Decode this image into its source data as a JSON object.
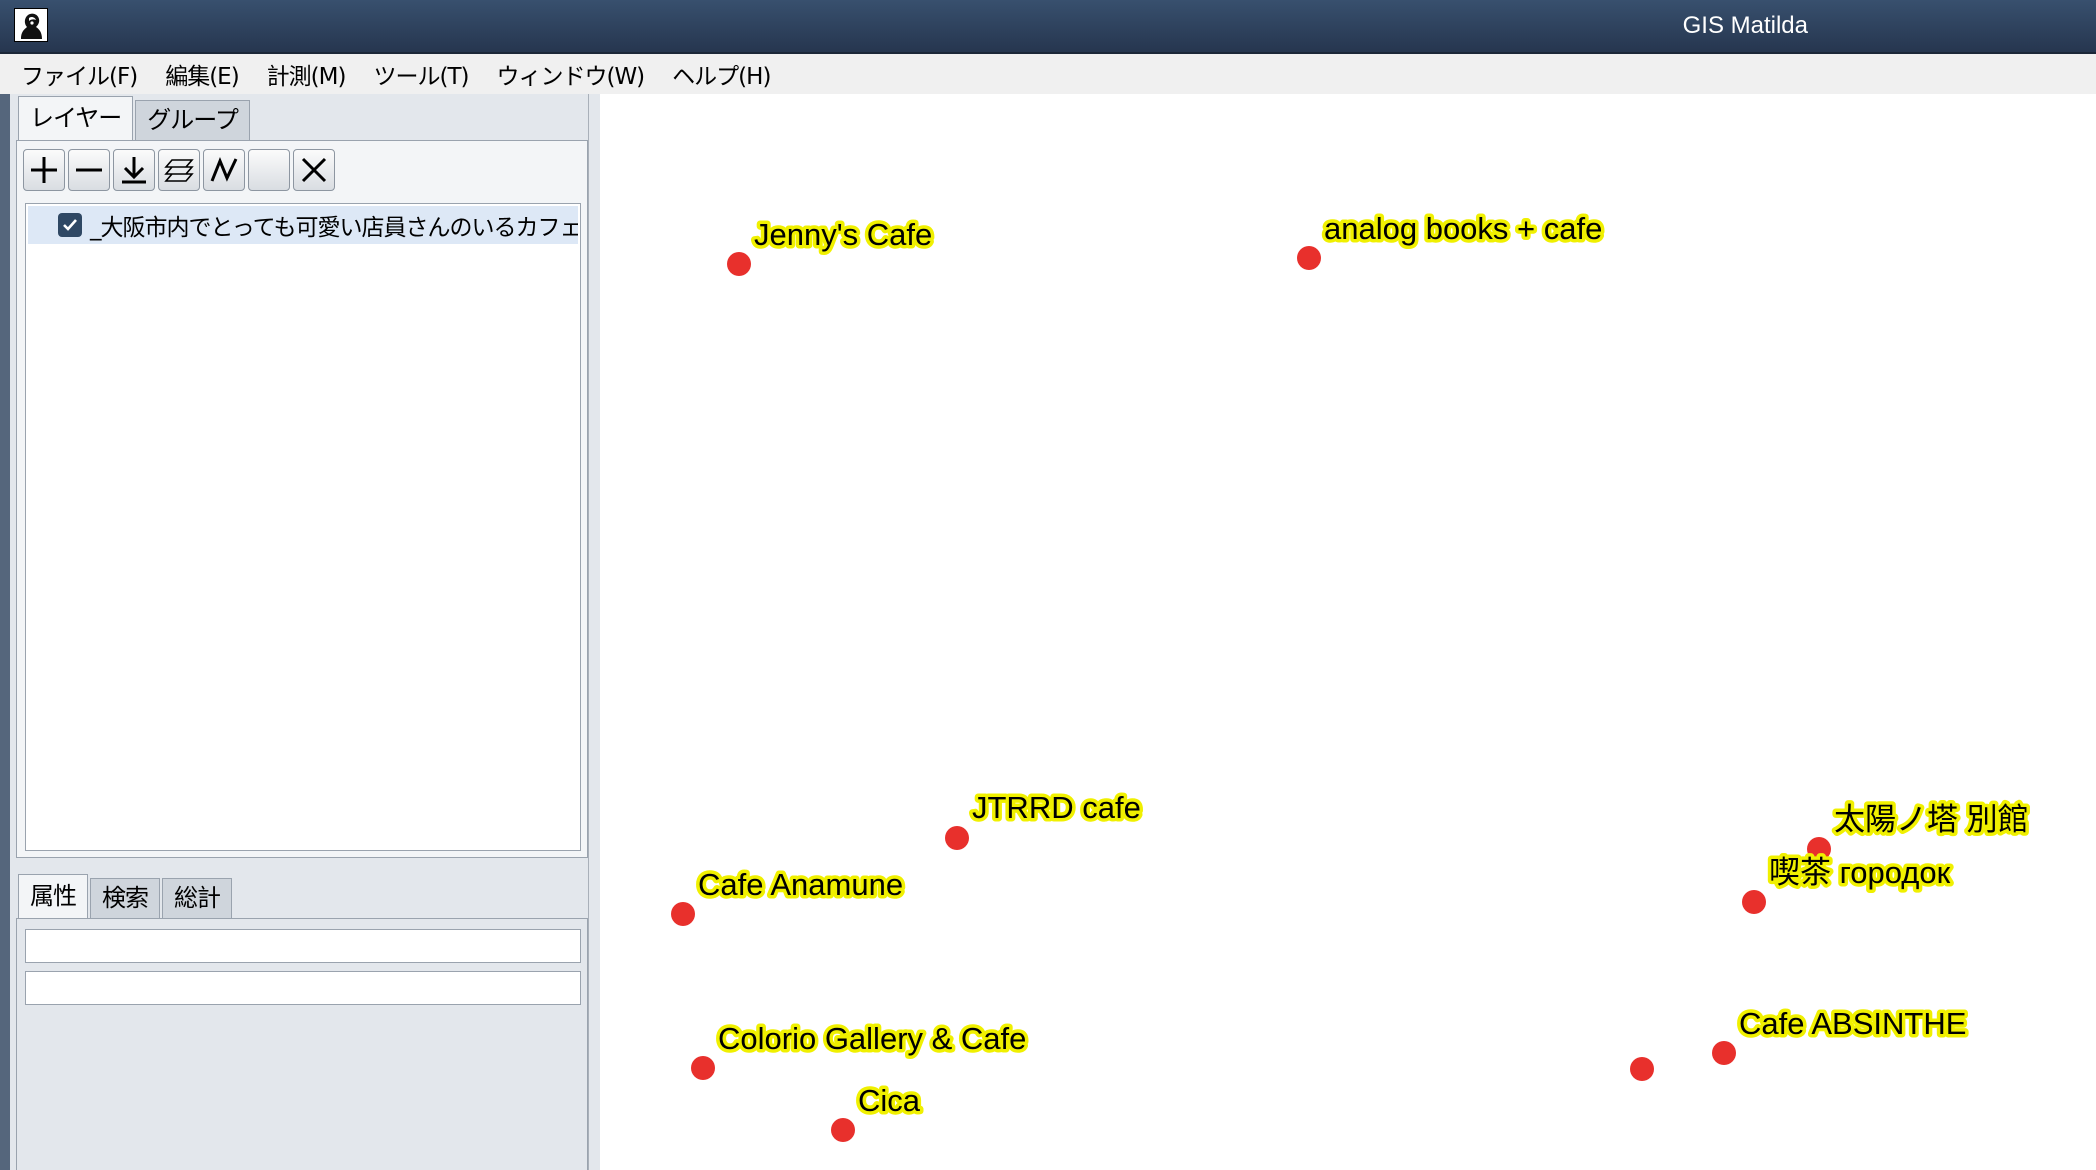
{
  "window": {
    "title": "GIS Matilda",
    "icon": "matilda-app-icon"
  },
  "menu": [
    "ファイル(F)",
    "編集(E)",
    "計測(M)",
    "ツール(T)",
    "ウィンドウ(W)",
    "ヘルプ(H)"
  ],
  "layer_panel": {
    "tabs": [
      "レイヤー",
      "グループ"
    ],
    "active_tab": "レイヤー",
    "toolbar": [
      {
        "name": "add-layer-button",
        "icon": "plus-icon"
      },
      {
        "name": "remove-layer-button",
        "icon": "minus-icon"
      },
      {
        "name": "import-button",
        "icon": "download-arrow-icon"
      },
      {
        "name": "layer-style-button",
        "icon": "stacked-layers-icon"
      },
      {
        "name": "polyline-button",
        "icon": "polyline-icon"
      },
      {
        "name": "blank-tool-button",
        "icon": "blank-icon"
      },
      {
        "name": "close-layer-button",
        "icon": "x-icon"
      }
    ],
    "layers": [
      {
        "name": "_大阪市内でとっても可愛い店員さんのいるカフェ",
        "checked": true
      }
    ]
  },
  "info_panel": {
    "tabs": [
      "属性",
      "検索",
      "総計"
    ],
    "active_tab": "属性",
    "fields": [
      "",
      ""
    ]
  },
  "map": {
    "point_color": "#e8302c",
    "label_halo_color": "#f0f000",
    "points": [
      {
        "label": "Jenny's Cafe"
      },
      {
        "label": "analog books + cafe"
      },
      {
        "label": "JTRRD cafe"
      },
      {
        "label": "Cafe Anamune"
      },
      {
        "label": "太陽ノ塔 別館"
      },
      {
        "label": "喫茶 городок"
      },
      {
        "label": "Colorio Gallery & Cafe"
      },
      {
        "label": "Cica"
      },
      {
        "label": "Cafe ABSINTHE"
      },
      {
        "label": ""
      }
    ]
  }
}
